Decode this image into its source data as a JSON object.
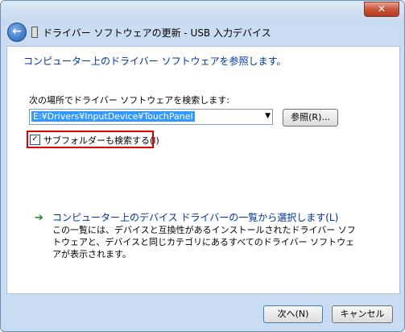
{
  "window": {
    "close_glyph": "✕"
  },
  "nav": {
    "back_glyph": "←",
    "title": "ドライバー ソフトウェアの更新 - USB 入力デバイス"
  },
  "main": {
    "heading": "コンピューター上のドライバー ソフトウェアを参照します。",
    "search_label": "次の場所でドライバー ソフトウェアを検索します:",
    "path_value": "E:¥Drivers¥InputDevice¥TouchPanel",
    "browse_label": "参照(R)...",
    "include_subfolders": {
      "checked": true,
      "check_glyph": "✓",
      "label": "サブフォルダーも検索する(I)"
    },
    "pick_from_list": {
      "arrow_glyph": "➔",
      "link": "コンピューター上のデバイス ドライバーの一覧から選択します(L)",
      "description": "この一覧には、デバイスと互換性があるインストールされたドライバー ソフトウェアと、デバイスと同じカテゴリにあるすべてのドライバー ソフトウェアが表示されます。"
    }
  },
  "footer": {
    "next_label": "次へ(N)",
    "cancel_label": "キャンセル"
  }
}
